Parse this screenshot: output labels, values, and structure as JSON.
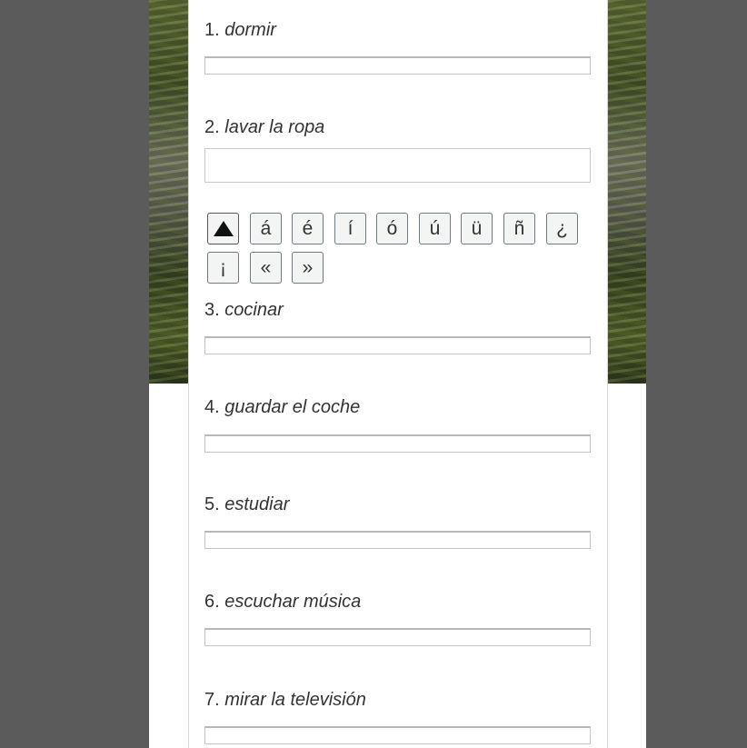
{
  "questions": [
    {
      "number": "1.",
      "verb": "dormir",
      "value": ""
    },
    {
      "number": "2.",
      "verb": "lavar la ropa",
      "value": ""
    },
    {
      "number": "3.",
      "verb": "cocinar",
      "value": ""
    },
    {
      "number": "4.",
      "verb": "guardar el coche",
      "value": ""
    },
    {
      "number": "5.",
      "verb": "estudiar",
      "value": ""
    },
    {
      "number": "6.",
      "verb": "escuchar música",
      "value": ""
    },
    {
      "number": "7.",
      "verb": "mirar la televisión",
      "value": ""
    }
  ],
  "accent_keyboard": {
    "toggle_icon": "triangle-up-icon",
    "keys": [
      "á",
      "é",
      "í",
      "ó",
      "ú",
      "ü",
      "ñ",
      "¿",
      "¡",
      "«",
      "»"
    ]
  },
  "colors": {
    "outside_background": "#5b5b5b",
    "panel_background": "#ffffff",
    "key_border": "#6f7b7f",
    "text": "#333333"
  }
}
